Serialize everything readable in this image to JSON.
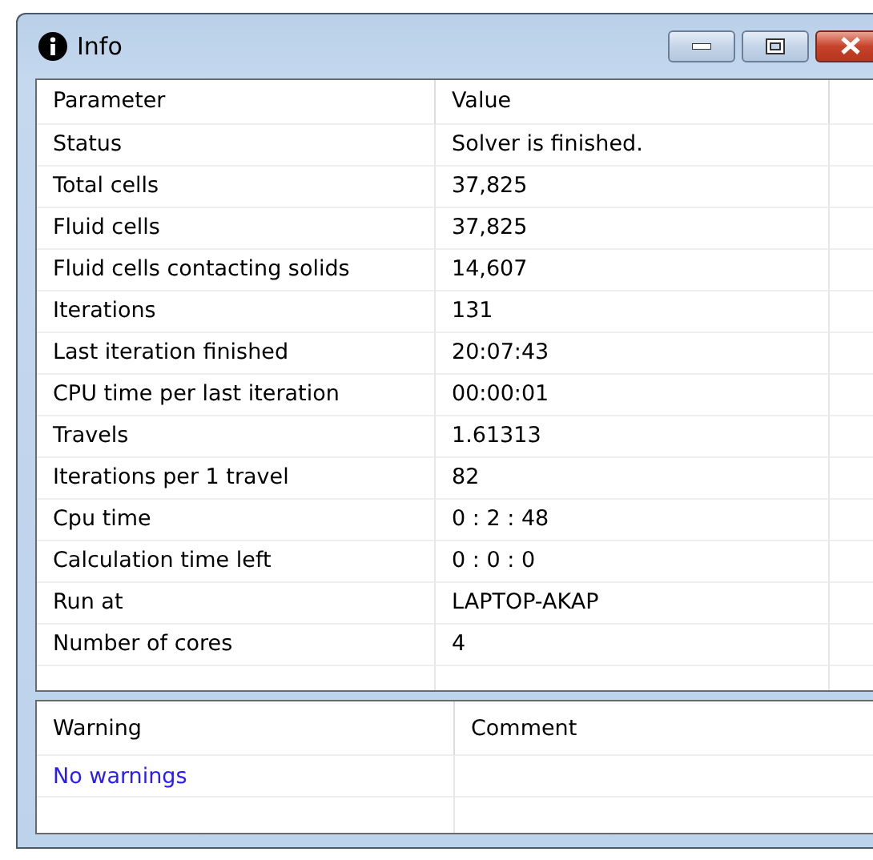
{
  "window": {
    "title": "Info"
  },
  "parameters": {
    "columns": [
      "Parameter",
      "Value"
    ],
    "rows": [
      {
        "parameter": "Status",
        "value": "Solver is finished."
      },
      {
        "parameter": "Total cells",
        "value": "37,825"
      },
      {
        "parameter": "Fluid cells",
        "value": "37,825"
      },
      {
        "parameter": "Fluid cells contacting solids",
        "value": "14,607"
      },
      {
        "parameter": "Iterations",
        "value": "131"
      },
      {
        "parameter": "Last iteration finished",
        "value": "20:07:43"
      },
      {
        "parameter": "CPU time per last iteration",
        "value": "00:00:01"
      },
      {
        "parameter": "Travels",
        "value": "1.61313"
      },
      {
        "parameter": "Iterations per 1 travel",
        "value": "82"
      },
      {
        "parameter": "Cpu time",
        "value": "0 : 2 : 48"
      },
      {
        "parameter": "Calculation time left",
        "value": "0 : 0 : 0"
      },
      {
        "parameter": "Run at",
        "value": "LAPTOP-AKAP"
      },
      {
        "parameter": "Number of cores",
        "value": "4"
      }
    ]
  },
  "warnings": {
    "columns": [
      "Warning",
      "Comment"
    ],
    "rows": [
      {
        "warning": "No warnings"
      }
    ]
  }
}
